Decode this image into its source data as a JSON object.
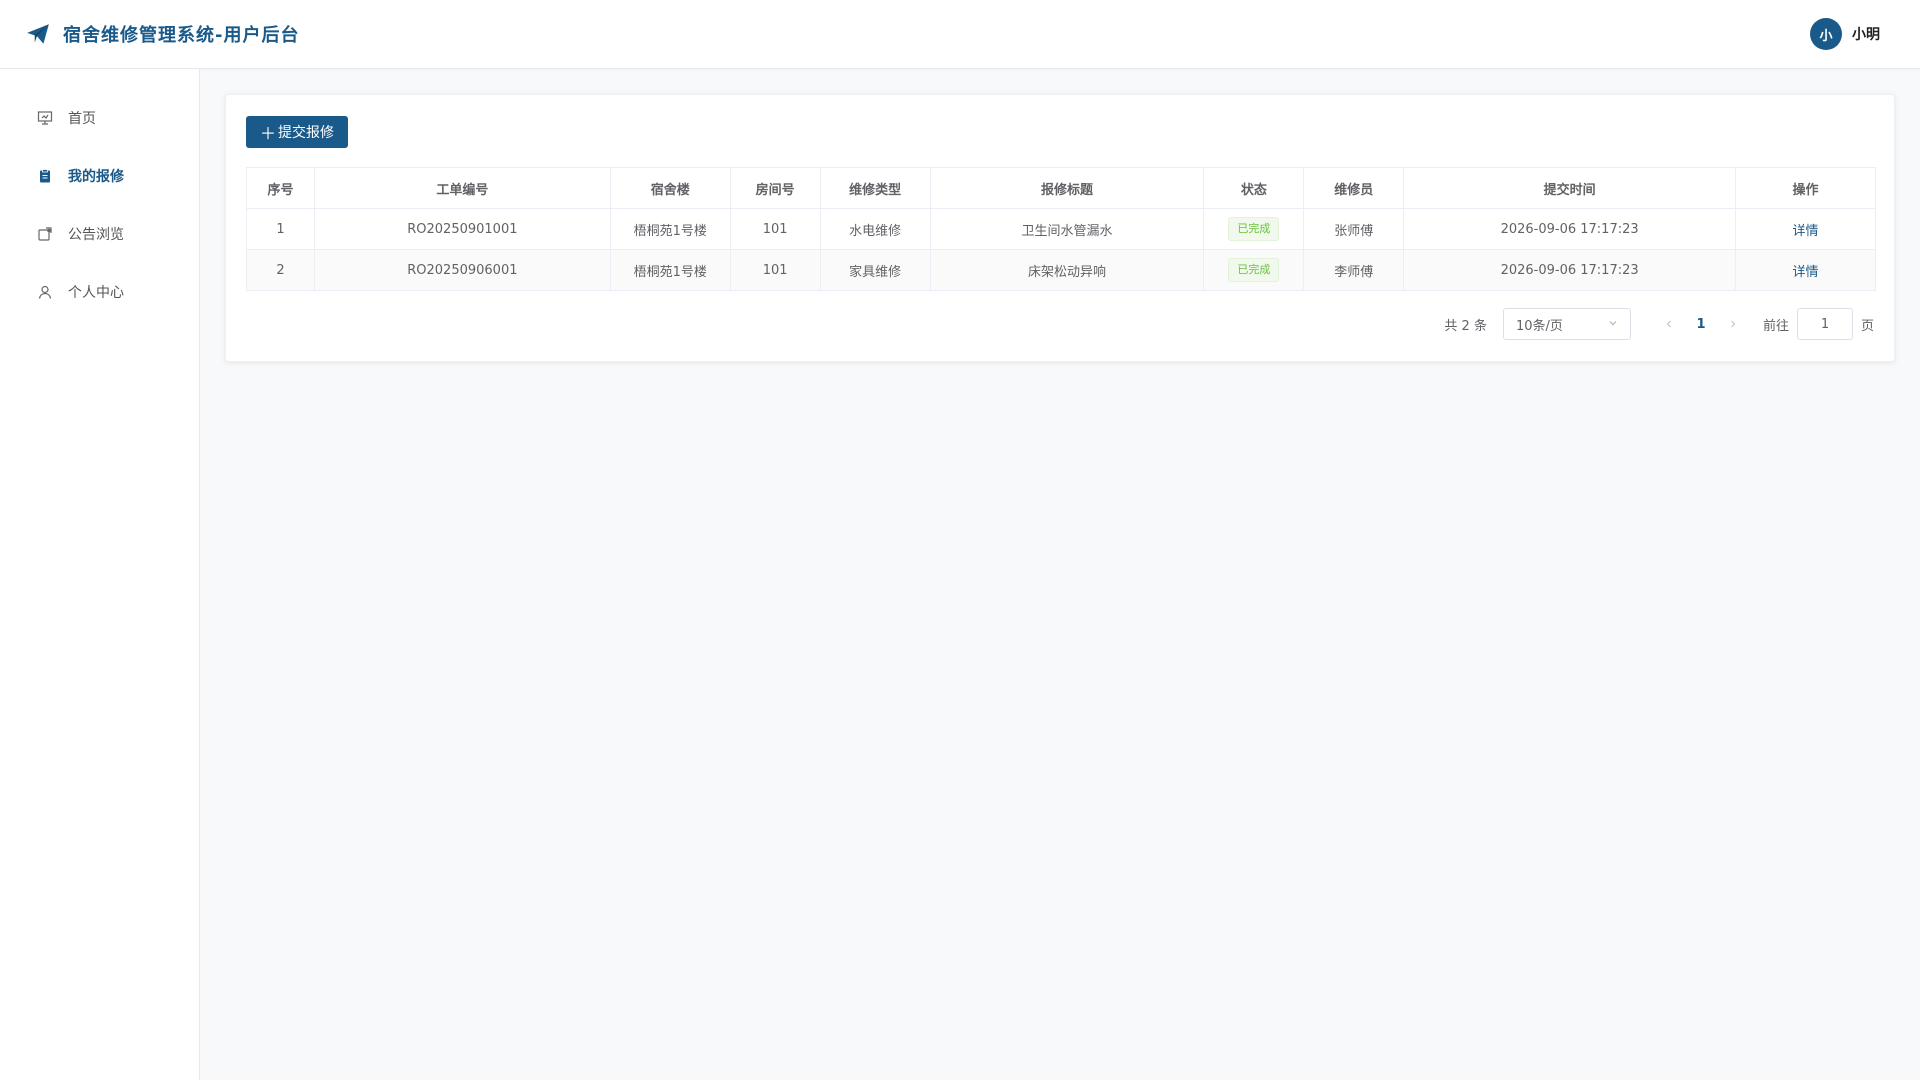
{
  "header": {
    "title": "宿舍维修管理系统-用户后台",
    "brand_color": "#1a5a8a",
    "user": {
      "avatar_text": "小",
      "name": "小明"
    }
  },
  "sidebar": {
    "items": [
      {
        "label": "首页",
        "icon": "presentation-icon",
        "active": false
      },
      {
        "label": "我的报修",
        "icon": "clipboard-icon",
        "active": true
      },
      {
        "label": "公告浏览",
        "icon": "notice-icon",
        "active": false
      },
      {
        "label": "个人中心",
        "icon": "user-icon",
        "active": false
      }
    ]
  },
  "main": {
    "submit_button": "提交报修",
    "table": {
      "columns": [
        "序号",
        "工单编号",
        "宿舍楼",
        "房间号",
        "维修类型",
        "报修标题",
        "状态",
        "维修员",
        "提交时间",
        "操作"
      ],
      "rows": [
        {
          "index": "1",
          "order_no": "RO20250901001",
          "building": "梧桐苑1号楼",
          "room": "101",
          "type": "水电维修",
          "title": "卫生间水管漏水",
          "status": "已完成",
          "worker": "张师傅",
          "time": "2026-09-06 17:17:23",
          "action": "详情"
        },
        {
          "index": "2",
          "order_no": "RO20250906001",
          "building": "梧桐苑1号楼",
          "room": "101",
          "type": "家具维修",
          "title": "床架松动异响",
          "status": "已完成",
          "worker": "李师傅",
          "time": "2026-09-06 17:17:23",
          "action": "详情"
        }
      ]
    },
    "pagination": {
      "total_text": "共 2 条",
      "page_size": "10条/页",
      "current_page": "1",
      "goto_label": "前往",
      "goto_value": "1",
      "goto_unit": "页"
    }
  }
}
